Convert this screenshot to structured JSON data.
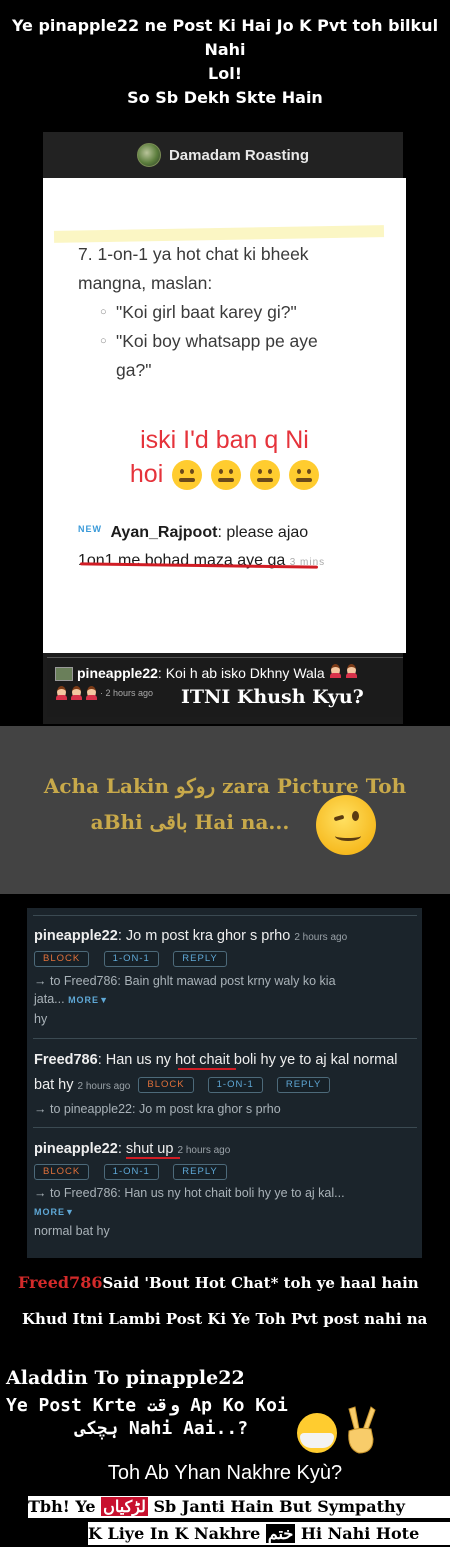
{
  "caption": {
    "line1": "Ye pinapple22 ne Post Ki Hai Jo K Pvt toh bilkul Nahi",
    "line2": "Lol!",
    "line3": "So Sb Dekh Skte Hain"
  },
  "shot1": {
    "title": "Damadam Roasting",
    "item_line1": "7. 1-on-1 ya hot chat ki bheek",
    "item_line2": "mangna, maslan:",
    "sub1": "\"Koi girl baat karey gi?\"",
    "sub2_line1": "\"Koi boy whatsapp pe aye",
    "sub2_line2": "ga?\"",
    "red_line1": "iski I'd ban q Ni",
    "red_line2": "hoi",
    "comment_new": "NEW",
    "comment_user": "Ayan_Rajpoot",
    "comment_text1": ": please ajao",
    "comment_text2": "1on1 me bohad maza aye ga",
    "comment_time": "3 mins",
    "footer_user": "pineapple22",
    "footer_text": ": Koi h ab isko Dkhny Wala",
    "footer_time": "· 2 hours ago",
    "overlay": "ITNI Khush Kyu?"
  },
  "gray": {
    "line1": "Acha Lakin روکو zara Picture Toh",
    "line2": "aBhi باقی Hai na..."
  },
  "shot2": {
    "c1_user": "pineapple22",
    "c1_text": ": Jo m post kra ghor s prho",
    "c1_time": "2 hours ago",
    "btn_block": "BLOCK",
    "btn_one": "1-ON-1",
    "btn_reply": "REPLY",
    "c1_reply": "→ to Freed786: Bain ghlt mawad post krny waly ko kia",
    "c1_reply2": "jata...",
    "more": "MORE▼",
    "c1_extra": "hy",
    "c2_user": "Freed786",
    "c2_text1a": ": Han us ny ",
    "c2_text1b": "hot chait",
    "c2_text1c": " boli hy ye to aj kal normal",
    "c2_text2": "bat hy",
    "c2_time": "2 hours ago",
    "c2_reply": "→ to pineapple22: Jo m post kra ghor s prho",
    "c3_user": "pineapple22",
    "c3_text": "shut up",
    "c3_time": "2 hours ago",
    "c3_reply": "→ to Freed786: Han us ny hot chait boli hy ye to aj kal...",
    "c3_extra": "normal bat hy"
  },
  "bottom": {
    "freed_name": "Freed786",
    "freed_text": "Said 'Bout Hot Chat* toh ye haal hain",
    "khud": "Khud Itni Lambi Post Ki Ye Toh Pvt post nahi na",
    "aladdin": "Aladdin To pinapple22",
    "ye_post": "Ye Post Krte وقت Ap Ko Koi",
    "nahi_aai": "ہچکی Nahi Aai..?",
    "toh_ab": "Toh Ab Yhan Nakhre Kyù?",
    "banner1_a": "Tbh! Ye ",
    "banner1_urdu": "لڑکیاں",
    "banner1_b": " Sb Janti Hain But  Sympathy",
    "banner2_a": "K Liye In K Nakhre ",
    "banner2_urdu": "ختم",
    "banner2_b": " Hi Nahi Hote"
  }
}
